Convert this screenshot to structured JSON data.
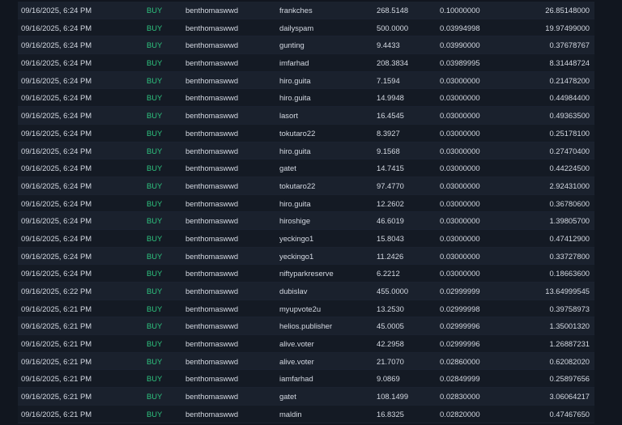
{
  "accent": {
    "buy": "#2ec27e",
    "background": "#11161f",
    "row_alt": "#1a212d",
    "row": "#141a24",
    "text": "#d4d9e2"
  },
  "trades": [
    {
      "date": "09/16/2025, 6:24 PM",
      "type": "BUY",
      "buyer": "benthomaswwd",
      "seller": "frankches",
      "quantity": "268.5148",
      "price": "0.10000000",
      "total": "26.85148000"
    },
    {
      "date": "09/16/2025, 6:24 PM",
      "type": "BUY",
      "buyer": "benthomaswwd",
      "seller": "dailyspam",
      "quantity": "500.0000",
      "price": "0.03994998",
      "total": "19.97499000"
    },
    {
      "date": "09/16/2025, 6:24 PM",
      "type": "BUY",
      "buyer": "benthomaswwd",
      "seller": "gunting",
      "quantity": "9.4433",
      "price": "0.03990000",
      "total": "0.37678767"
    },
    {
      "date": "09/16/2025, 6:24 PM",
      "type": "BUY",
      "buyer": "benthomaswwd",
      "seller": "imfarhad",
      "quantity": "208.3834",
      "price": "0.03989995",
      "total": "8.31448724"
    },
    {
      "date": "09/16/2025, 6:24 PM",
      "type": "BUY",
      "buyer": "benthomaswwd",
      "seller": "hiro.guita",
      "quantity": "7.1594",
      "price": "0.03000000",
      "total": "0.21478200"
    },
    {
      "date": "09/16/2025, 6:24 PM",
      "type": "BUY",
      "buyer": "benthomaswwd",
      "seller": "hiro.guita",
      "quantity": "14.9948",
      "price": "0.03000000",
      "total": "0.44984400"
    },
    {
      "date": "09/16/2025, 6:24 PM",
      "type": "BUY",
      "buyer": "benthomaswwd",
      "seller": "lasort",
      "quantity": "16.4545",
      "price": "0.03000000",
      "total": "0.49363500"
    },
    {
      "date": "09/16/2025, 6:24 PM",
      "type": "BUY",
      "buyer": "benthomaswwd",
      "seller": "tokutaro22",
      "quantity": "8.3927",
      "price": "0.03000000",
      "total": "0.25178100"
    },
    {
      "date": "09/16/2025, 6:24 PM",
      "type": "BUY",
      "buyer": "benthomaswwd",
      "seller": "hiro.guita",
      "quantity": "9.1568",
      "price": "0.03000000",
      "total": "0.27470400"
    },
    {
      "date": "09/16/2025, 6:24 PM",
      "type": "BUY",
      "buyer": "benthomaswwd",
      "seller": "gatet",
      "quantity": "14.7415",
      "price": "0.03000000",
      "total": "0.44224500"
    },
    {
      "date": "09/16/2025, 6:24 PM",
      "type": "BUY",
      "buyer": "benthomaswwd",
      "seller": "tokutaro22",
      "quantity": "97.4770",
      "price": "0.03000000",
      "total": "2.92431000"
    },
    {
      "date": "09/16/2025, 6:24 PM",
      "type": "BUY",
      "buyer": "benthomaswwd",
      "seller": "hiro.guita",
      "quantity": "12.2602",
      "price": "0.03000000",
      "total": "0.36780600"
    },
    {
      "date": "09/16/2025, 6:24 PM",
      "type": "BUY",
      "buyer": "benthomaswwd",
      "seller": "hiroshige",
      "quantity": "46.6019",
      "price": "0.03000000",
      "total": "1.39805700"
    },
    {
      "date": "09/16/2025, 6:24 PM",
      "type": "BUY",
      "buyer": "benthomaswwd",
      "seller": "yeckingo1",
      "quantity": "15.8043",
      "price": "0.03000000",
      "total": "0.47412900"
    },
    {
      "date": "09/16/2025, 6:24 PM",
      "type": "BUY",
      "buyer": "benthomaswwd",
      "seller": "yeckingo1",
      "quantity": "11.2426",
      "price": "0.03000000",
      "total": "0.33727800"
    },
    {
      "date": "09/16/2025, 6:24 PM",
      "type": "BUY",
      "buyer": "benthomaswwd",
      "seller": "niftyparkreserve",
      "quantity": "6.2212",
      "price": "0.03000000",
      "total": "0.18663600"
    },
    {
      "date": "09/16/2025, 6:22 PM",
      "type": "BUY",
      "buyer": "benthomaswwd",
      "seller": "dubislav",
      "quantity": "455.0000",
      "price": "0.02999999",
      "total": "13.64999545"
    },
    {
      "date": "09/16/2025, 6:21 PM",
      "type": "BUY",
      "buyer": "benthomaswwd",
      "seller": "myupvote2u",
      "quantity": "13.2530",
      "price": "0.02999998",
      "total": "0.39758973"
    },
    {
      "date": "09/16/2025, 6:21 PM",
      "type": "BUY",
      "buyer": "benthomaswwd",
      "seller": "helios.publisher",
      "quantity": "45.0005",
      "price": "0.02999996",
      "total": "1.35001320"
    },
    {
      "date": "09/16/2025, 6:21 PM",
      "type": "BUY",
      "buyer": "benthomaswwd",
      "seller": "alive.voter",
      "quantity": "42.2958",
      "price": "0.02999996",
      "total": "1.26887231"
    },
    {
      "date": "09/16/2025, 6:21 PM",
      "type": "BUY",
      "buyer": "benthomaswwd",
      "seller": "alive.voter",
      "quantity": "21.7070",
      "price": "0.02860000",
      "total": "0.62082020"
    },
    {
      "date": "09/16/2025, 6:21 PM",
      "type": "BUY",
      "buyer": "benthomaswwd",
      "seller": "iamfarhad",
      "quantity": "9.0869",
      "price": "0.02849999",
      "total": "0.25897656"
    },
    {
      "date": "09/16/2025, 6:21 PM",
      "type": "BUY",
      "buyer": "benthomaswwd",
      "seller": "gatet",
      "quantity": "108.1499",
      "price": "0.02830000",
      "total": "3.06064217"
    },
    {
      "date": "09/16/2025, 6:21 PM",
      "type": "BUY",
      "buyer": "benthomaswwd",
      "seller": "maldin",
      "quantity": "16.8325",
      "price": "0.02820000",
      "total": "0.47467650"
    }
  ]
}
